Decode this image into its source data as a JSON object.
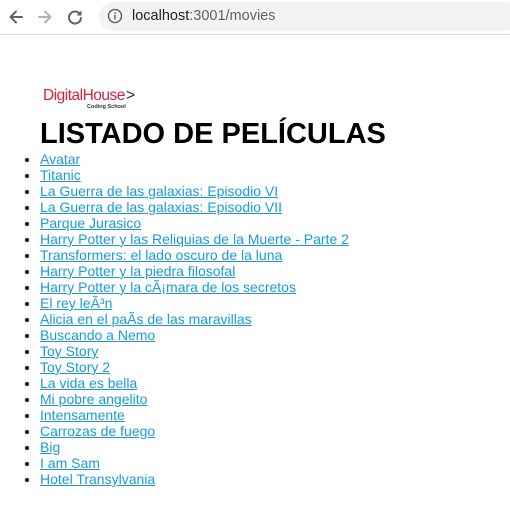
{
  "browser": {
    "url_host": "localhost",
    "url_rest": ":3001/movies"
  },
  "logo": {
    "brand": "DigitalHouse",
    "arrow": ">",
    "tagline": "Coding School"
  },
  "page": {
    "title": "LISTADO DE PELÍCULAS"
  },
  "movies": [
    "Avatar",
    "Titanic",
    "La Guerra de las galaxias: Episodio VI",
    "La Guerra de las galaxias: Episodio VII",
    "Parque Jurasico",
    "Harry Potter y las Reliquias de la Muerte - Parte 2",
    "Transformers: el lado oscuro de la luna",
    "Harry Potter y la piedra filosofal",
    "Harry Potter y la cÃ¡mara de los secretos",
    "El rey leÃ³n",
    "Alicia en el paÃ­s de las maravillas",
    "Buscando a Nemo",
    "Toy Story",
    "Toy Story 2",
    "La vida es bella",
    "Mi pobre angelito",
    "Intensamente",
    "Carrozas de fuego",
    "Big",
    "I am Sam",
    "Hotel Transylvania"
  ]
}
